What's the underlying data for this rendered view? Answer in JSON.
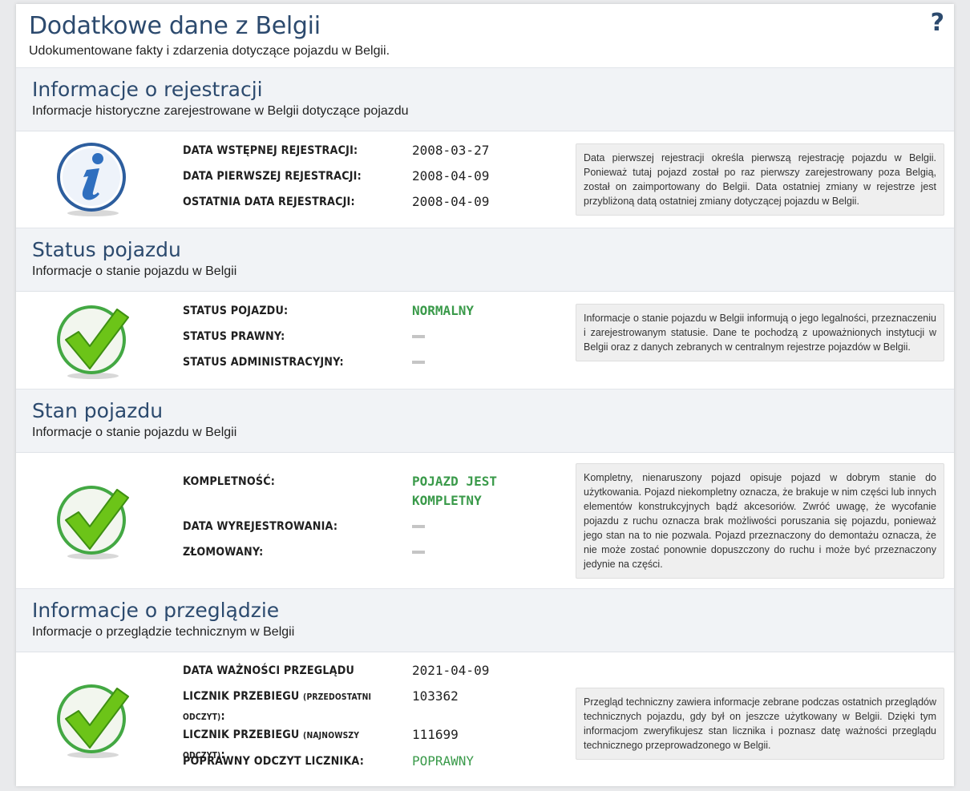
{
  "page": {
    "title": "Dodatkowe dane z Belgii",
    "subtitle": "Udokumentowane fakty i zdarzenia dotyczące pojazdu w Belgii.",
    "help": "?"
  },
  "sections": [
    {
      "title": "Informacje o rejestracji",
      "subtitle": "Informacje historyczne zarejestrowane w Belgii dotyczące pojazdu",
      "icon": "info-icon",
      "rows": [
        {
          "label": "DATA WSTĘPNEJ REJESTRACJI:",
          "value": "2008-03-27"
        },
        {
          "label": "DATA PIERWSZEJ REJESTRACJI:",
          "value": "2008-04-09"
        },
        {
          "label": "OSTATNIA DATA REJESTRACJI:",
          "value": "2008-04-09"
        }
      ],
      "note": "Data pierwszej rejestracji określa pierwszą rejestrację pojazdu w Belgii. Ponieważ tutaj pojazd został po raz pierwszy zarejestrowany poza Belgią, został on zaimportowany do Belgii. Data ostatniej zmiany w rejestrze jest przybliżoną datą ostatniej zmiany dotyczącej pojazdu w Belgii."
    },
    {
      "title": "Status pojazdu",
      "subtitle": "Informacje o stanie pojazdu w Belgii",
      "icon": "checkmark-icon",
      "rows": [
        {
          "label": "STATUS POJAZDU:",
          "value": "NORMALNY"
        },
        {
          "label": "STATUS PRAWNY:",
          "value": ""
        },
        {
          "label": "STATUS ADMINISTRACYJNY:",
          "value": ""
        }
      ],
      "note": "Informacje o stanie pojazdu w Belgii informują o jego legalności, przeznaczeniu i zarejestrowanym statusie. Dane te pochodzą z upoważnionych instytucji w Belgii oraz z danych zebranych w centralnym rejestrze pojazdów w Belgii."
    },
    {
      "title": "Stan pojazdu",
      "subtitle": "Informacje o stanie pojazdu w Belgii",
      "icon": "checkmark-icon",
      "rows": [
        {
          "label": "KOMPLETNOŚĆ:",
          "value_line1": "POJAZD JEST",
          "value_line2": "KOMPLETNY"
        },
        {
          "label": "DATA WYREJESTROWANIA:",
          "value": ""
        },
        {
          "label": "ZŁOMOWANY:",
          "value": ""
        }
      ],
      "note": "Kompletny, nienaruszony pojazd opisuje pojazd w dobrym stanie do użytkowania. Pojazd niekompletny oznacza, że brakuje w nim części lub innych elementów konstrukcyjnych bądź akcesoriów. Zwróć uwagę, że wycofanie pojazdu z ruchu oznacza brak możliwości poruszania się pojazdu, ponieważ jego stan na to nie pozwala. Pojazd przeznaczony do demontażu oznacza, że nie może zostać ponownie dopuszczony do ruchu i może być przeznaczony jedynie na części."
    },
    {
      "title": "Informacje o przeglądzie",
      "subtitle": "Informacje o przeglądzie technicznym w Belgii",
      "icon": "checkmark-icon",
      "rows": [
        {
          "label": "DATA WAŻNOŚCI PRZEGLĄDU",
          "value": "2021-04-09"
        },
        {
          "label": "LICZNIK PRZEBIEGU",
          "label_small": "(PRZEDOSTATNI",
          "label_line2": "ODCZYT)",
          "label_tail": ":",
          "value": "103362"
        },
        {
          "label": "LICZNIK PRZEBIEGU",
          "label_small": "(NAJNOWSZY ODCZYT)",
          "label_tail": ":",
          "value": "111699"
        },
        {
          "label": "POPRAWNY ODCZYT LICZNIKA:",
          "value": "POPRAWNY"
        }
      ],
      "note": "Przegląd techniczny zawiera informacje zebrane podczas ostatnich przeglądów technicznych pojazdu, gdy był on jeszcze użytkowany w Belgii. Dzięki tym informacjom zweryfikujesz stan licznika i poznasz datę ważności przeglądu technicznego przeprowadzonego w Belgii."
    }
  ],
  "colors": {
    "title": "#2c4a6e",
    "good": "#3a9a4a",
    "section_bg": "#f1f3f6",
    "note_bg": "#efefef"
  }
}
